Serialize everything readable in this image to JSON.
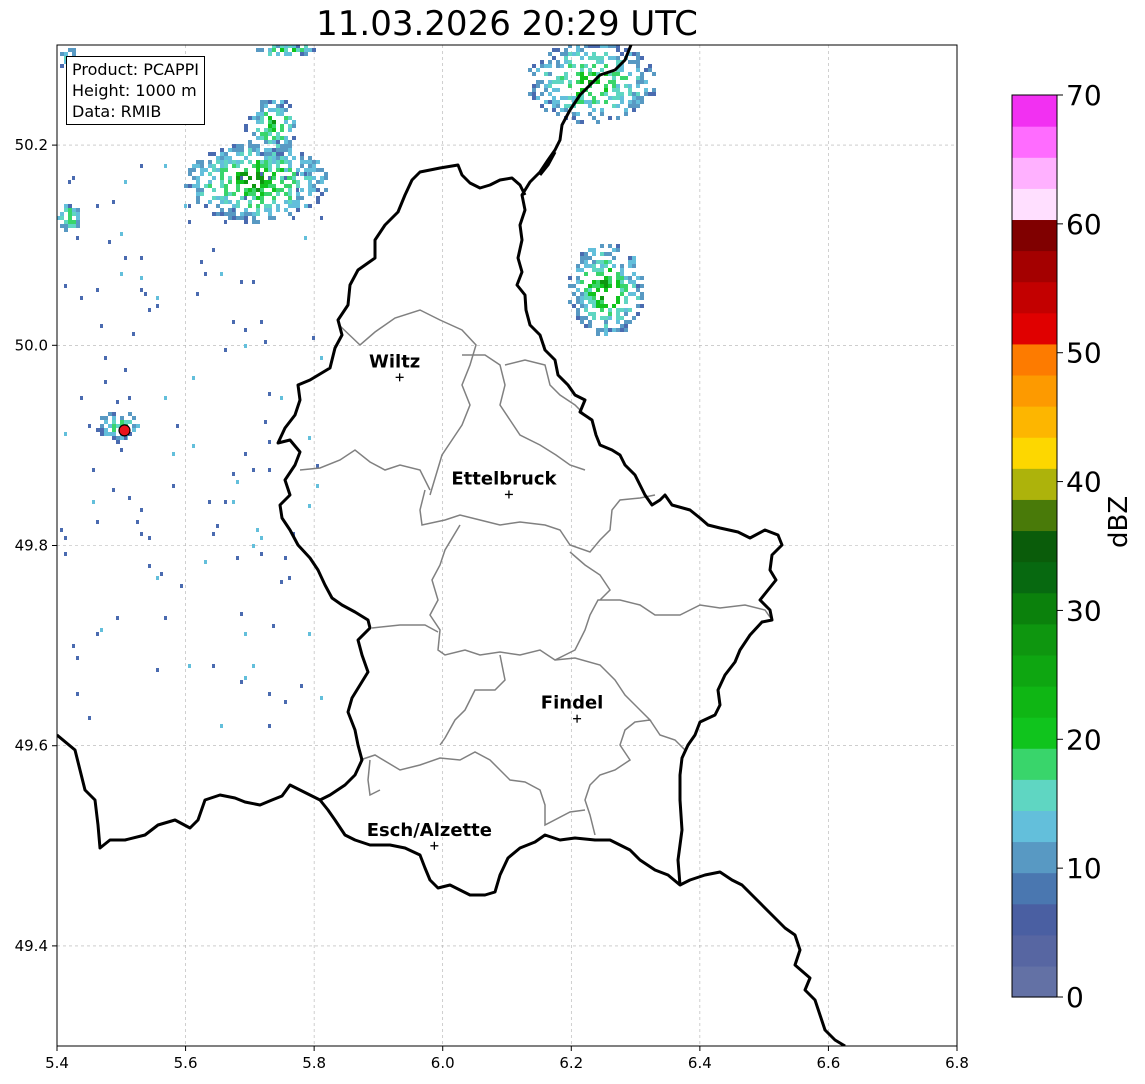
{
  "title": "11.03.2026 20:29 UTC",
  "info": {
    "product": "Product: PCAPPI",
    "height": "Height: 1000 m",
    "source": "Data: RMIB"
  },
  "map": {
    "lon_range": [
      5.4,
      6.8
    ],
    "lat_range": [
      49.3,
      50.3
    ],
    "lon_ticks": [
      "5.4",
      "5.6",
      "5.8",
      "6.0",
      "6.2",
      "6.4",
      "6.6",
      "6.8"
    ],
    "lat_ticks": [
      "49.4",
      "49.6",
      "49.8",
      "50.0",
      "50.2"
    ],
    "grid": true,
    "cities": [
      {
        "name": "Wiltz",
        "lon": 5.933,
        "lat": 49.968
      },
      {
        "name": "Ettelbruck",
        "lon": 6.103,
        "lat": 49.851
      },
      {
        "name": "Findel",
        "lon": 6.209,
        "lat": 49.627
      },
      {
        "name": "Esch/Alzette",
        "lon": 5.987,
        "lat": 49.5
      }
    ],
    "radar_site": {
      "lon": 5.505,
      "lat": 49.915,
      "color": "#e8141c"
    },
    "border_color": "#000000",
    "canton_color": "#808080"
  },
  "colorbar": {
    "label": "dBZ",
    "range": [
      0,
      70
    ],
    "tick_labels": [
      "0",
      "10",
      "20",
      "30",
      "40",
      "50",
      "60",
      "70"
    ],
    "colors": [
      "#6371a5",
      "#5766a2",
      "#4a5fa2",
      "#4a77b0",
      "#5899c3",
      "#63bfdb",
      "#5fd6c2",
      "#39d56b",
      "#10c41d",
      "#0fb614",
      "#0ea611",
      "#0e960f",
      "#0b810c",
      "#076910",
      "#0a5c0a",
      "#497a09",
      "#adb30b",
      "#fdd700",
      "#fdb600",
      "#fd9a00",
      "#fd7b00",
      "#e00000",
      "#c30000",
      "#a40000",
      "#800000",
      "#ffdfff",
      "#ffb1ff",
      "#ff6cff",
      "#f230f2"
    ]
  },
  "echo_colors": [
    "#4a6bb0",
    "#5899c3",
    "#63bfdb",
    "#5fd6c2",
    "#39d56b",
    "#10c41d",
    "#0e960f",
    "#076910"
  ]
}
